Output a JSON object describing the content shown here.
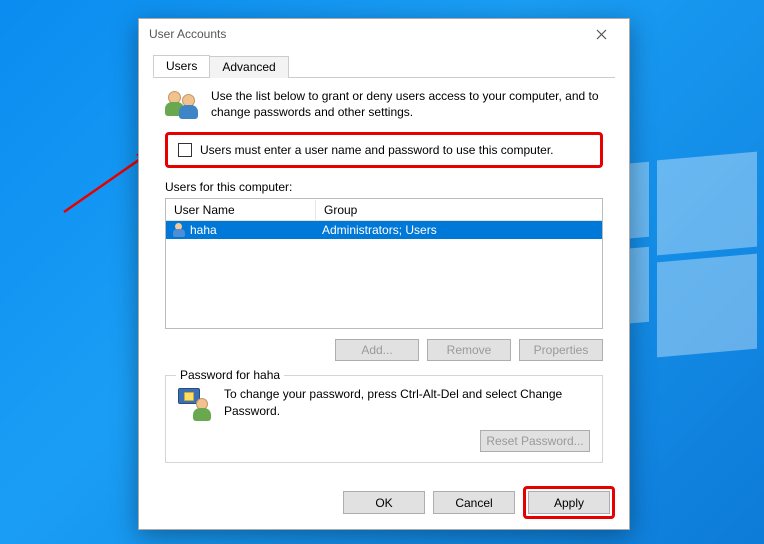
{
  "dialog": {
    "title": "User Accounts",
    "tabs": {
      "users": "Users",
      "advanced": "Advanced"
    },
    "intro_text": "Use the list below to grant or deny users access to your computer, and to change passwords and other settings.",
    "checkbox_label": "Users must enter a user name and password to use this computer.",
    "users_list_label": "Users for this computer:",
    "columns": {
      "username": "User Name",
      "group": "Group"
    },
    "rows": [
      {
        "username": "haha",
        "group": "Administrators; Users"
      }
    ],
    "buttons": {
      "add": "Add...",
      "remove": "Remove",
      "properties": "Properties"
    },
    "password_section": {
      "legend": "Password for haha",
      "text": "To change your password, press Ctrl-Alt-Del and select Change Password.",
      "reset_btn": "Reset Password..."
    },
    "footer": {
      "ok": "OK",
      "cancel": "Cancel",
      "apply": "Apply"
    }
  }
}
